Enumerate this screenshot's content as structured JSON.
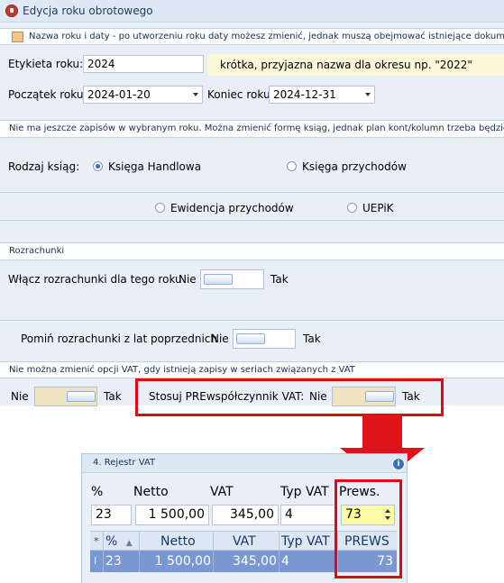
{
  "window": {
    "title": "Edycja roku obrotowego"
  },
  "form": {
    "section_info": "Nazwa roku i daty - po utworzeniu roku daty możesz zmienić, jednak muszą obejmować istniejące dokumenty",
    "label_name": "Etykieta roku:",
    "name_value": "2024",
    "name_hint": "krótka, przyjazna nazwa dla okresu np. \"2022\"",
    "label_start": "Początek roku",
    "start_value": "2024-01-20",
    "label_end": "Koniec roku",
    "end_value": "2024-12-31",
    "section_books_info": "Nie ma jeszcze zapisów w wybranym roku. Można zmienić formę ksiąg, jednak plan kont/kolumn trzeba będzie popr",
    "label_book_kind": "Rodzaj ksiąg:",
    "book_options": [
      {
        "label": "Księga Handlowa",
        "selected": true
      },
      {
        "label": "Księga przychodów",
        "selected": false
      },
      {
        "label": "Ewidencja przychodów",
        "selected": false
      },
      {
        "label": "UEPiK",
        "selected": false
      }
    ],
    "section_settlements": "Rozrachunki",
    "label_enable_settlements": "Włącz rozrachunki dla tego roku",
    "label_skip_settlements": "Pomiń rozrachunki z lat poprzednich",
    "no_label": "Nie",
    "yes_label": "Tak",
    "section_vat_info": "Nie można zmienić opcji VAT, gdy istnieją zapisy w seriach związanych z VAT",
    "label_prewspolczynnik": "Stosuj PREwspółczynnik VAT:"
  },
  "vat_register": {
    "title": "4. Rejestr VAT",
    "info_icon": "i",
    "fields": {
      "labels": [
        "%",
        "Netto",
        "VAT",
        "Typ VAT",
        "Prews."
      ],
      "values": [
        "23",
        "1 500,00",
        "345,00",
        "4",
        "73"
      ]
    },
    "grid": {
      "row_marker_head": "*",
      "row_marker": "I",
      "sort_indicator": "▲",
      "columns": [
        "%",
        "Netto",
        "VAT",
        "Typ VAT",
        "PREWS"
      ],
      "rows": [
        [
          "23",
          "1 500,00",
          "345,00",
          "4",
          "73"
        ]
      ]
    }
  },
  "colors": {
    "highlight_red": "#e30613",
    "selected_row": "#7b97d1",
    "active_field": "#fdfba8"
  }
}
